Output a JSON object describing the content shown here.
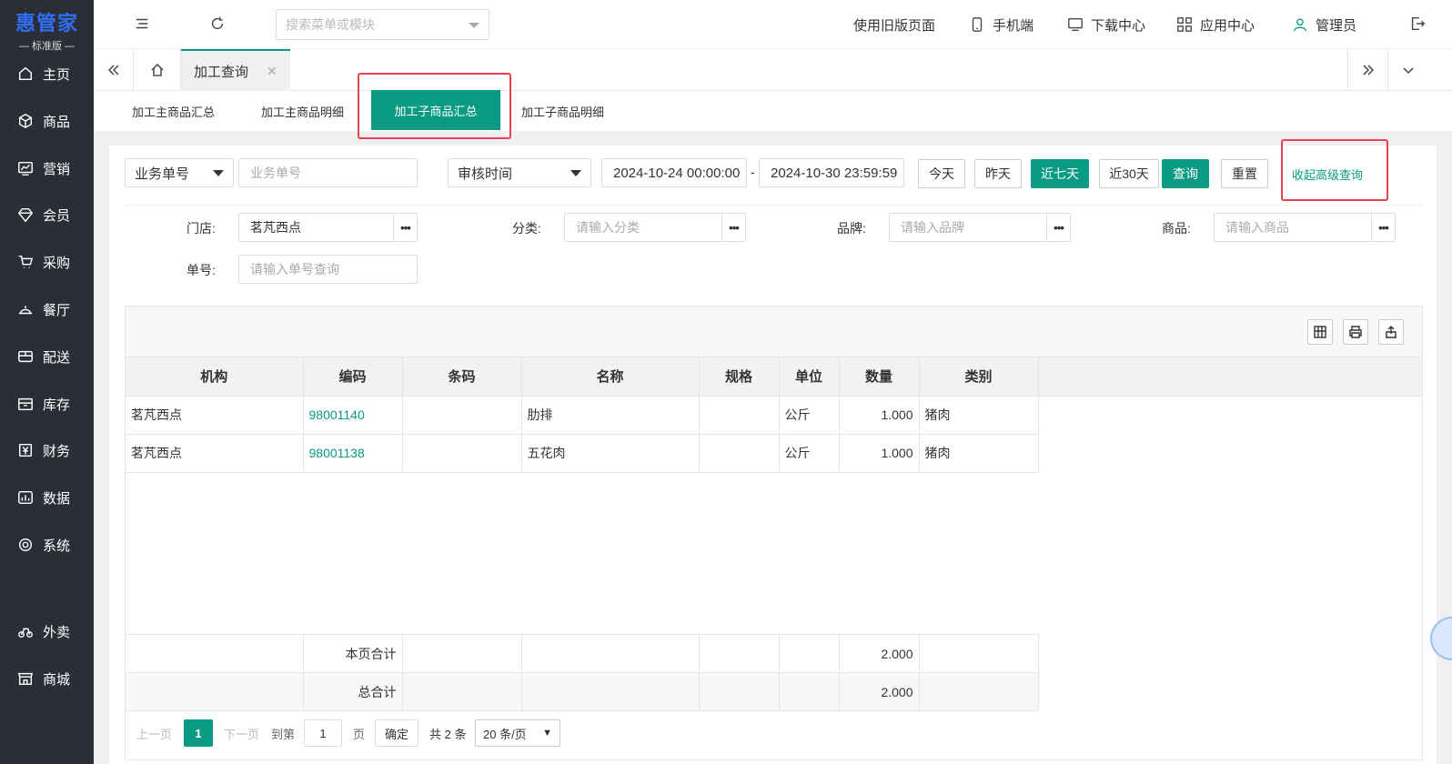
{
  "app": {
    "logo": "惠管家",
    "edition": "— 标准版 —"
  },
  "sidebar": {
    "items": [
      {
        "label": "主页",
        "icon": "home-icon"
      },
      {
        "label": "商品",
        "icon": "box-icon"
      },
      {
        "label": "营销",
        "icon": "chart-icon"
      },
      {
        "label": "会员",
        "icon": "diamond-icon"
      },
      {
        "label": "采购",
        "icon": "cart-icon"
      },
      {
        "label": "餐厅",
        "icon": "cloche-icon"
      },
      {
        "label": "配送",
        "icon": "delivery-icon"
      },
      {
        "label": "库存",
        "icon": "archive-icon"
      },
      {
        "label": "财务",
        "icon": "yen-icon"
      },
      {
        "label": "数据",
        "icon": "data-icon"
      },
      {
        "label": "系统",
        "icon": "gear-icon"
      },
      {
        "label": "外卖",
        "icon": "bike-icon"
      },
      {
        "label": "商城",
        "icon": "store-icon"
      }
    ]
  },
  "topbar": {
    "search_placeholder": "搜索菜单或模块",
    "old_page": "使用旧版页面",
    "mobile": "手机端",
    "download": "下载中心",
    "apps": "应用中心",
    "user": "管理员"
  },
  "tabs": {
    "active": "加工查询"
  },
  "subtabs": [
    "加工主商品汇总",
    "加工主商品明细",
    "加工子商品汇总",
    "加工子商品明细"
  ],
  "filters": {
    "doc_type": "业务单号",
    "doc_placeholder": "业务单号",
    "time_type": "审核时间",
    "date_start": "2024-10-24 00:00:00",
    "date_sep": "-",
    "date_end": "2024-10-30 23:59:59",
    "btn_today": "今天",
    "btn_yesterday": "昨天",
    "btn_7days": "近七天",
    "btn_30days": "近30天",
    "btn_query": "查询",
    "btn_reset": "重置",
    "collapse": "收起高级查询",
    "store_label": "门店:",
    "store_value": "茗芃西点",
    "category_label": "分类:",
    "category_placeholder": "请输入分类",
    "brand_label": "品牌:",
    "brand_placeholder": "请输入品牌",
    "product_label": "商品:",
    "product_placeholder": "请输入商品",
    "order_label": "单号:",
    "order_placeholder": "请输入单号查询"
  },
  "table": {
    "columns": [
      "机构",
      "编码",
      "条码",
      "名称",
      "规格",
      "单位",
      "数量",
      "类别"
    ],
    "rows": [
      [
        "茗芃西点",
        "98001140",
        "",
        "肋排",
        "",
        "公斤",
        "1.000",
        "猪肉"
      ],
      [
        "茗芃西点",
        "98001138",
        "",
        "五花肉",
        "",
        "公斤",
        "1.000",
        "猪肉"
      ]
    ],
    "page_total_label": "本页合计",
    "page_total": "2.000",
    "grand_total_label": "总合计",
    "grand_total": "2.000"
  },
  "pager": {
    "prev": "上一页",
    "current": "1",
    "next": "下一页",
    "goto": "到第",
    "page_input": "1",
    "page_unit": "页",
    "confirm": "确定",
    "total": "共 2 条",
    "page_size": "20 条/页"
  },
  "colors": {
    "accent": "#0b9a83",
    "sidebar": "#2b2e36",
    "highlight": "#e8414f",
    "logo": "#2f6ff5"
  }
}
